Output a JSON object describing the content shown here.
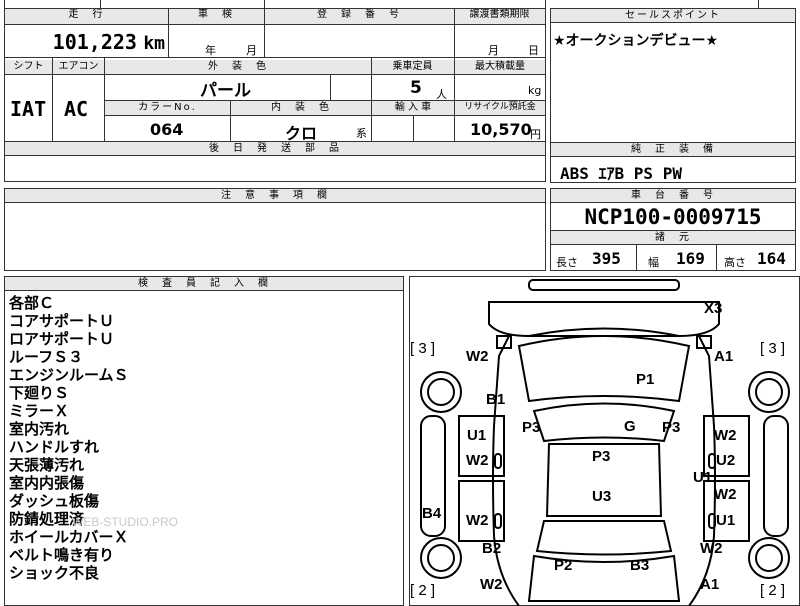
{
  "top_row": {
    "mileage_label": "走　行",
    "mileage_value": "101,223",
    "mileage_unit": "km",
    "inspection_label": "車　検",
    "inspection_year_unit": "年",
    "inspection_month_unit": "月",
    "registration_label": "登　録　番　号",
    "transfer_label": "譲渡書類期限",
    "transfer_month_unit": "月",
    "transfer_day_unit": "日"
  },
  "spec_row": {
    "shift_label": "シフト",
    "shift_value": "IAT",
    "ac_label": "エアコン",
    "ac_value": "AC",
    "exterior_color_label": "外　装　色",
    "exterior_color_value": "パール",
    "capacity_label": "乗車定員",
    "capacity_value": "5",
    "capacity_unit": "人",
    "max_load_label": "最大積載量",
    "max_load_unit": "kg",
    "color_no_label": "カラーNo.",
    "color_no_value": "064",
    "interior_color_label": "内　装　色",
    "interior_color_value": "クロ",
    "interior_color_suffix": "系",
    "import_label": "輸 入 車",
    "recycle_label": "リサイクル預託金",
    "recycle_value": "10,570",
    "recycle_unit": "円"
  },
  "later_parts_label": "後　日　発　送　部　品",
  "sales_point": {
    "label": "セールスポイント",
    "text": "★オークションデビュー★"
  },
  "genuine_equipment": {
    "label": "純　正　装　備",
    "text": "ABS ｴｱB PS PW"
  },
  "caution_label": "注　意　事　項　欄",
  "chassis": {
    "label": "車　台　番　号",
    "value": "NCP100-0009715",
    "dims_label": "諸　元",
    "length_label": "長さ",
    "length_value": "395",
    "width_label": "幅",
    "width_value": "169",
    "height_label": "高さ",
    "height_value": "164"
  },
  "inspector": {
    "label": "検　査　員　記　入　欄",
    "notes": [
      "各部Ｃ",
      "コアサポートＵ",
      "ロアサポートＵ",
      "ルーフＳ３",
      "エンジンルームＳ",
      "下廻りＳ",
      "ミラーＸ",
      "室内汚れ",
      "ハンドルすれ",
      "天張薄汚れ",
      "室内内張傷",
      "ダッシュ板傷",
      "防錆処理済",
      "ホイールカバーＸ",
      "ベルト鳴き有り",
      "ショック不良"
    ],
    "watermark": "WEB-STUDIO.PRO"
  },
  "diagram": {
    "tire_marks": [
      "[ 3 ]",
      "[ 3 ]",
      "[ 2 ]",
      "[ 2 ]"
    ],
    "marks": [
      "X3",
      "W2",
      "A1",
      "P1",
      "B1",
      "U1",
      "P3",
      "G",
      "P3",
      "W2",
      "W2",
      "P3",
      "U2",
      "U1",
      "U3",
      "W2",
      "B4",
      "W2",
      "U1",
      "B2",
      "W2",
      "P2",
      "B3",
      "W2",
      "A1"
    ]
  }
}
